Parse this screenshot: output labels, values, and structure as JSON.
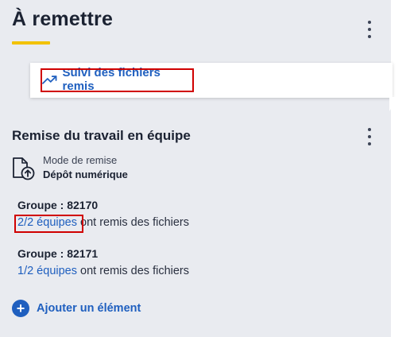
{
  "header": {
    "title": "À remettre"
  },
  "popup_menu": {
    "item_label": "Suivi des fichiers remis",
    "item_icon": "trending-up-icon"
  },
  "card": {
    "title": "Remise du travail en équipe",
    "mode": {
      "label": "Mode de remise",
      "value": "Dépôt numérique",
      "icon": "file-upload-icon"
    },
    "groups": [
      {
        "name": "Groupe : 82170",
        "teams_link": "2/2 équipes",
        "suffix": "ont remis des fichiers"
      },
      {
        "name": "Groupe : 82171",
        "teams_link": "1/2 équipes",
        "suffix": "ont remis des fichiers"
      }
    ],
    "add_label": "Ajouter un élément"
  },
  "colors": {
    "panel_bg": "#e9ebf0",
    "accent_link": "#1f5fbf",
    "underline": "#f2c200",
    "highlight": "#d00000"
  }
}
